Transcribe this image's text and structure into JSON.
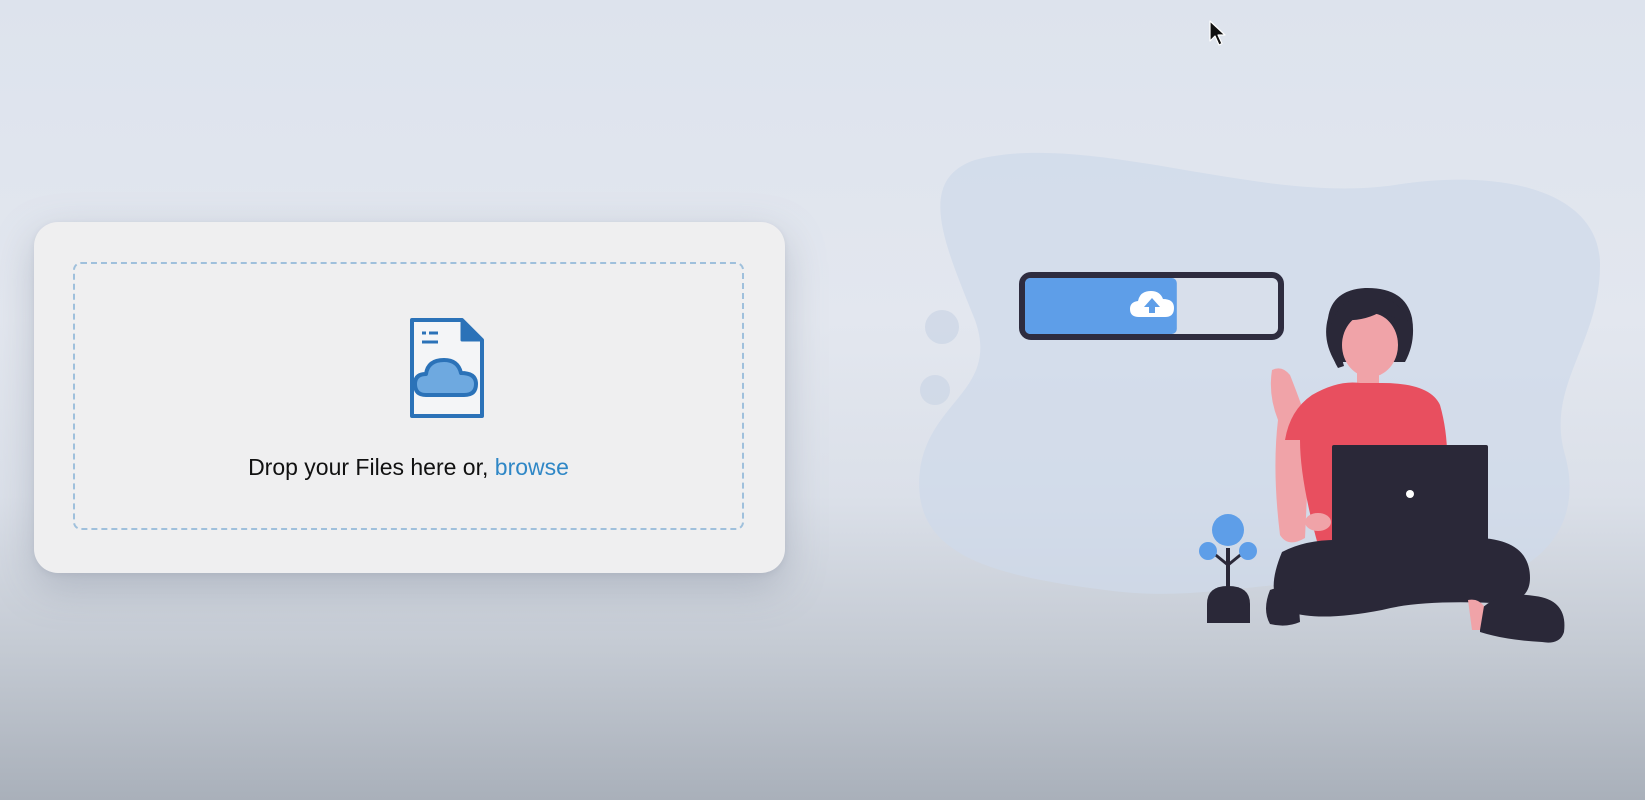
{
  "upload": {
    "prompt_text": "Drop your Files here or,",
    "browse_label": "browse"
  },
  "icons": {
    "file_icon": "cloud-file-icon",
    "upload_icon": "cloud-upload-icon",
    "cursor": "mouse-pointer-icon"
  },
  "progress": {
    "value": 0.6
  },
  "colors": {
    "accent": "#2f87c6",
    "progress_fill": "#5e9ee8",
    "shirt": "#e84f5f",
    "dark": "#2a2838"
  }
}
